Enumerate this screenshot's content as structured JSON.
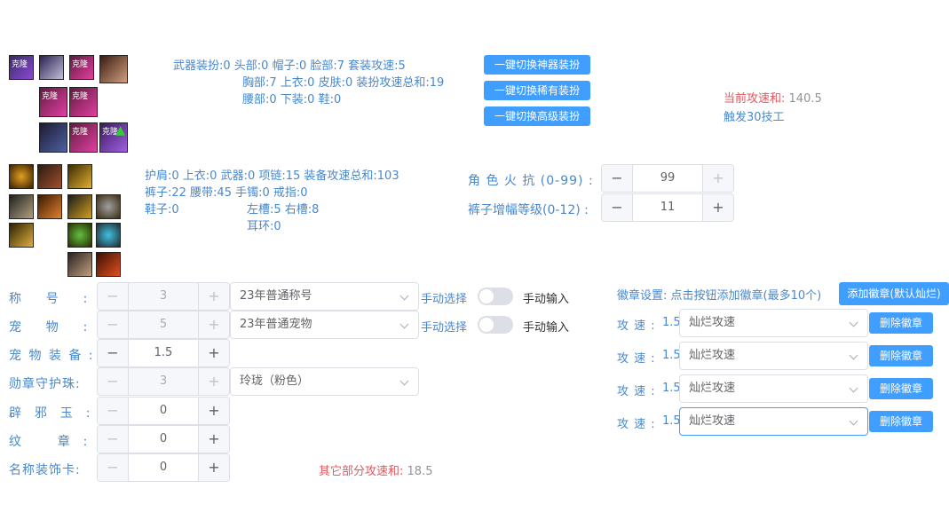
{
  "equip_top": {
    "line1": "武器装扮:0  头部:0  帽子:0  脸部:7  套装攻速:5",
    "line2": "胸部:7  上衣:0  皮肤:0  装扮攻速总和:19",
    "line3": "腰部:0  下装:0  鞋:0"
  },
  "buttons": {
    "artifact": "一键切换神器装扮",
    "rare": "一键切换稀有装扮",
    "advanced": "一键切换高级装扮"
  },
  "summary": {
    "current_label": "当前攻速和:",
    "current_value": "140.5",
    "trigger": "触发30技工"
  },
  "equip_mid": {
    "line1": "护肩:0  上衣:0  武器:0  项链:15  装备攻速总和:103",
    "line2a": "裤子:22  腰带:45  手镯:0  戒指:0",
    "line3a": "鞋子:0",
    "line3b": "左槽:5  右槽:8",
    "line4": "耳环:0"
  },
  "resist": {
    "fire_label": "角 色 火 抗 (0-99) :",
    "fire_value": "99",
    "pants_label": "裤子增幅等级(0-12) :",
    "pants_value": "11"
  },
  "rows": {
    "title": {
      "label": "称    号    :",
      "value": "3",
      "select": "23年普通称号",
      "manual_select": "手动选择",
      "manual_input": "手动输入"
    },
    "pet": {
      "label": "宠    物    :",
      "value": "5",
      "select": "23年普通宠物",
      "manual_select": "手动选择",
      "manual_input": "手动输入"
    },
    "pet_equip": {
      "label": "宠 物 装 备 :",
      "value": "1.5"
    },
    "medal_gem": {
      "label": "勋章守护珠:",
      "value": "3",
      "select": "玲珑（粉色）"
    },
    "jade": {
      "label": "辟  邪  玉  :",
      "value": "0"
    },
    "emblem": {
      "label": "纹      章  :",
      "value": "0"
    },
    "name_card": {
      "label": "名称装饰卡:",
      "value": "0"
    }
  },
  "other_sum": {
    "label": "其它部分攻速和:",
    "value": "18.5"
  },
  "emblems": {
    "settings": "徽章设置: 点击按钮添加徽章(最多10个)",
    "add_button": "添加徽章(默认灿烂)",
    "items": [
      {
        "label": "攻 速 :",
        "value": "1.5",
        "select": "灿烂攻速",
        "remove": "删除徽章"
      },
      {
        "label": "攻 速 :",
        "value": "1.5",
        "select": "灿烂攻速",
        "remove": "删除徽章"
      },
      {
        "label": "攻 速 :",
        "value": "1.5",
        "select": "灿烂攻速",
        "remove": "删除徽章"
      },
      {
        "label": "攻 速 :",
        "value": "1.5",
        "select": "灿烂攻速",
        "remove": "删除徽章"
      }
    ]
  },
  "icon_badges": {
    "set_badge": "克隆"
  },
  "stepper_symbols": {
    "minus": "−",
    "plus": "+"
  }
}
